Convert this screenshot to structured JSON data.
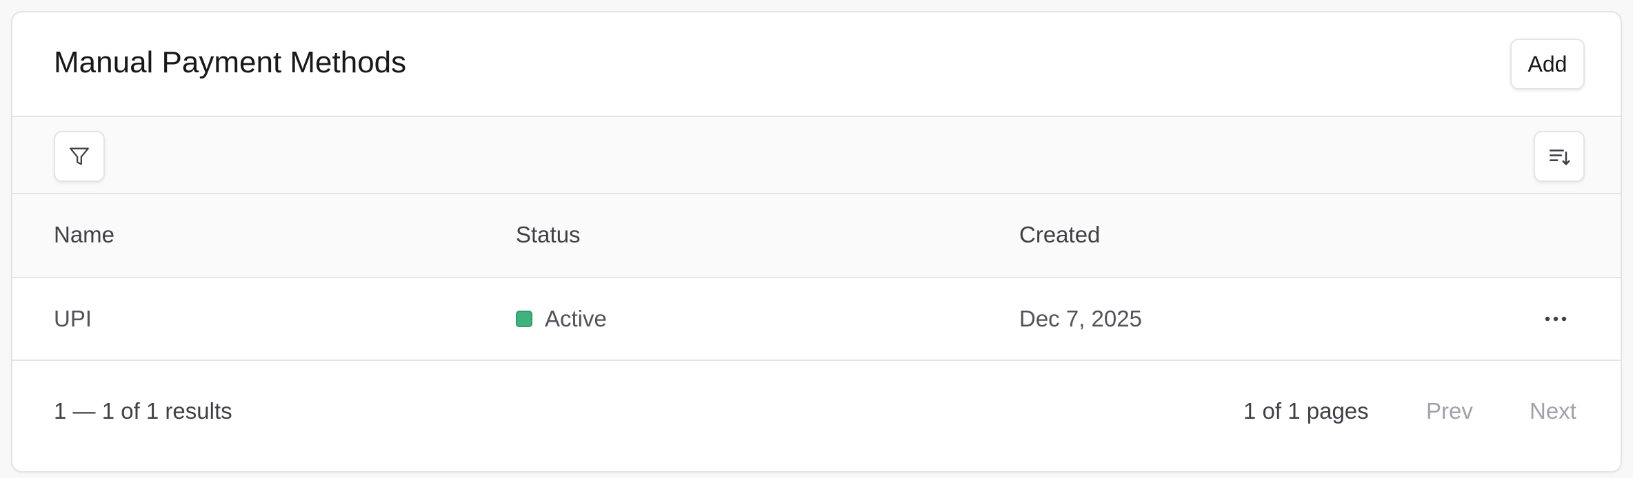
{
  "header": {
    "title": "Manual Payment Methods",
    "add_label": "Add"
  },
  "toolbar": {
    "filter_icon": "filter-icon",
    "sort_icon": "sort-descending-icon"
  },
  "table": {
    "columns": [
      "Name",
      "Status",
      "Created"
    ],
    "rows": [
      {
        "name": "UPI",
        "status": "Active",
        "status_color": "#3fb27f",
        "created": "Dec 7, 2025"
      }
    ]
  },
  "footer": {
    "results": "1 — 1 of 1 results",
    "pages": "1 of 1 pages",
    "prev_label": "Prev",
    "next_label": "Next"
  }
}
